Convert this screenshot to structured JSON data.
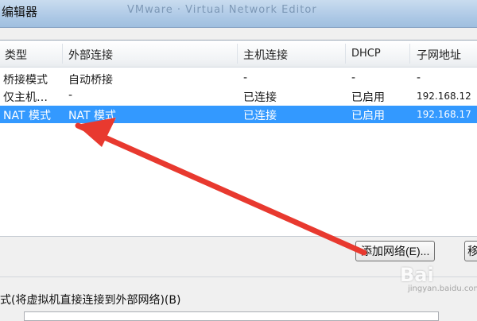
{
  "window": {
    "title": "编辑器",
    "title_ghost": "VMware · Virtual Network Editor"
  },
  "table": {
    "columns": [
      "类型",
      "外部连接",
      "主机连接",
      "DHCP",
      "子网地址"
    ],
    "rows": [
      {
        "type": "桥接模式",
        "external": "自动桥接",
        "host": "-",
        "dhcp": "-",
        "subnet": "-",
        "selected": false
      },
      {
        "type": "仅主机…",
        "external": "-",
        "host": "已连接",
        "dhcp": "已启用",
        "subnet": "192.168.12",
        "selected": false
      },
      {
        "type": "NAT 模式",
        "external": "NAT 模式",
        "host": "已连接",
        "dhcp": "已启用",
        "subnet": "192.168.17",
        "selected": true
      }
    ]
  },
  "buttons": {
    "add_network": "添加网络(E)...",
    "next_partial": "移"
  },
  "bottom": {
    "mode_text": "式(将虚拟机直接连接到外部网络)(B)"
  },
  "watermark": {
    "main": "Bai",
    "sub": "jingyan.baidu.com"
  },
  "colors": {
    "selection": "#3399ff",
    "arrow": "#e8392f"
  }
}
